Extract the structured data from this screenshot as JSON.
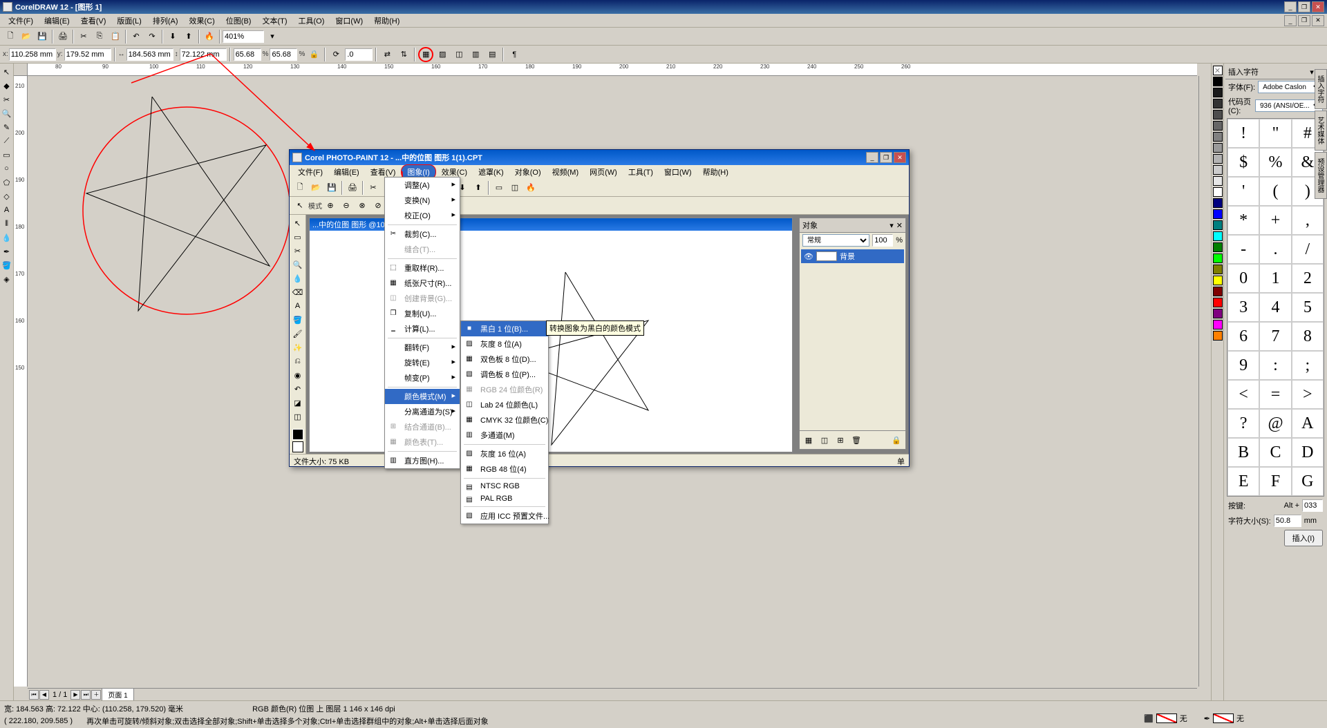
{
  "app": {
    "title": "CorelDRAW 12 - [图形 1]",
    "menubar": [
      "文件(F)",
      "编辑(E)",
      "查看(V)",
      "版面(L)",
      "排列(A)",
      "效果(C)",
      "位图(B)",
      "文本(T)",
      "工具(O)",
      "窗口(W)",
      "帮助(H)"
    ]
  },
  "toolbar": {
    "zoom": "401%"
  },
  "property": {
    "x_label": "x:",
    "y_label": "y:",
    "x": "110.258 mm",
    "y": "179.52 mm",
    "w_icon": "↔",
    "h_icon": "↕",
    "w": "184.563 mm",
    "h": "72.122 mm",
    "sx": "65.68",
    "sy": "65.68",
    "pct": "%",
    "rotate": ".0"
  },
  "ruler_h": [
    "80",
    "90",
    "100",
    "110",
    "120",
    "130",
    "140",
    "150",
    "160",
    "170",
    "180",
    "190",
    "200",
    "210",
    "220",
    "230",
    "240",
    "250",
    "260"
  ],
  "ruler_v": [
    "210",
    "200",
    "190",
    "180",
    "170",
    "160",
    "150"
  ],
  "page_nav": {
    "first": "⏮",
    "prev": "◀",
    "indicator": "1 / 1",
    "next": "▶",
    "last": "⏭",
    "add": "＋",
    "tab": "页面 1"
  },
  "status": {
    "line1_a": "宽: 184.563 高: 72.122 中心: (110.258, 179.520)  毫米",
    "line1_b": "RGB 颜色(R) 位图 上 图层 1 146 x 146 dpi",
    "line2_a": "( 222.180, 209.585 )",
    "line2_b": "再次单击可旋转/倾斜对象;双击选择全部对象;Shift+单击选择多个对象;Ctrl+单击选择群组中的对象;Alt+单击选择后面对象",
    "fill_none": "无",
    "outline_none": "无"
  },
  "right_panel": {
    "title": "插入字符",
    "font_label": "字体(F):",
    "font": "Adobe Caslon",
    "codepage_label": "代码页(C):",
    "codepage": "936  (ANSI/OE...",
    "chars": [
      "!",
      "\"",
      "#",
      "$",
      "%",
      "&",
      "'",
      "(",
      ")",
      "*",
      "+",
      ",",
      "-",
      ".",
      "/",
      "0",
      "1",
      "2",
      "3",
      "4",
      "5",
      "6",
      "7",
      "8",
      "9",
      ":",
      ";",
      "<",
      "=",
      ">",
      "?",
      "@",
      "A",
      "B",
      "C",
      "D",
      "E",
      "F",
      "G"
    ],
    "key_label": "按键:",
    "alt": "Alt +",
    "alt_val": "033",
    "size_label": "字符大小(S):",
    "size": "50.8",
    "unit": "mm",
    "insert": "插入(I)"
  },
  "colors": [
    "#ffffff",
    "#000000",
    "#1a1a1a",
    "#333333",
    "#4d4d4d",
    "#666666",
    "#808080",
    "#999999",
    "#b3b3b3",
    "#cccccc",
    "#00ffff",
    "#0000ff",
    "#ff00ff",
    "#ff0000",
    "#ffff00",
    "#00ff00",
    "#ff8000",
    "#8000ff",
    "#804000",
    "#c0e0ff"
  ],
  "photopaint": {
    "title": "Corel PHOTO-PAINT 12 - ...中的位图 图形 1(1).CPT",
    "menubar": [
      "文件(F)",
      "编辑(E)",
      "查看(V)",
      "图象(I)",
      "效果(C)",
      "遮罩(K)",
      "对象(O)",
      "视频(M)",
      "网页(W)",
      "工具(T)",
      "窗口(W)",
      "帮助(H)"
    ],
    "mode_label": "模式",
    "doc_title": "...中的位图 图形                           @100% - 背景",
    "object_panel": {
      "title": "对象",
      "mode": "常规",
      "opacity": "100",
      "pct": "%",
      "bg": "背景"
    },
    "status": "文件大小:  75 KB",
    "status_right": "单"
  },
  "image_menu": {
    "items": [
      {
        "label": "调整(A)",
        "arrow": true
      },
      {
        "label": "变换(N)",
        "arrow": true
      },
      {
        "label": "校正(O)",
        "arrow": true
      },
      {
        "sep": true
      },
      {
        "label": "裁剪(C)...",
        "icon": "✂"
      },
      {
        "label": "缝合(T)...",
        "disabled": true
      },
      {
        "sep": true
      },
      {
        "label": "重取样(R)...",
        "icon": "⬚"
      },
      {
        "label": "纸张尺寸(R)...",
        "icon": "▦"
      },
      {
        "label": "创建背景(G)...",
        "disabled": true,
        "icon": "◫"
      },
      {
        "label": "复制(U)...",
        "icon": "❐"
      },
      {
        "label": "计算(L)...",
        "icon": "‗"
      },
      {
        "sep": true
      },
      {
        "label": "翻转(F)",
        "arrow": true
      },
      {
        "label": "旋转(E)",
        "arrow": true
      },
      {
        "label": "帧变(P)",
        "arrow": true
      },
      {
        "sep": true
      },
      {
        "label": "颜色模式(M)",
        "arrow": true,
        "highlight": true
      },
      {
        "label": "分离通道为(S)",
        "arrow": true
      },
      {
        "label": "结合通道(B)...",
        "disabled": true,
        "icon": "⊞"
      },
      {
        "label": "颜色表(T)...",
        "disabled": true,
        "icon": "▦"
      },
      {
        "sep": true
      },
      {
        "label": "直方图(H)...",
        "icon": "▥"
      }
    ]
  },
  "colormode_menu": {
    "items": [
      {
        "label": "黑白 1 位(B)...",
        "highlight": true,
        "icon": "■"
      },
      {
        "label": "灰度 8 位(A)",
        "icon": "▨"
      },
      {
        "label": "双色板 8 位(D)...",
        "icon": "▦"
      },
      {
        "label": "调色板 8 位(P)...",
        "icon": "▧"
      },
      {
        "label": "RGB 24 位颜色(R)",
        "disabled": true,
        "icon": "▦"
      },
      {
        "label": "Lab 24 位颜色(L)",
        "icon": "◫"
      },
      {
        "label": "CMYK 32 位颜色(C)",
        "icon": "▦"
      },
      {
        "label": "多通道(M)",
        "icon": "▥"
      },
      {
        "sep": true
      },
      {
        "label": "灰度 16 位(A)",
        "icon": "▨"
      },
      {
        "label": "RGB 48 位(4)",
        "icon": "▦"
      },
      {
        "sep": true
      },
      {
        "label": "NTSC RGB",
        "icon": "▤"
      },
      {
        "label": "PAL RGB",
        "icon": "▤"
      },
      {
        "sep": true
      },
      {
        "label": "应用 ICC 预置文件...",
        "icon": "▧"
      }
    ]
  },
  "tooltip": "转换图象为黑白的颜色模式",
  "side_tabs": [
    "插入字符",
    "艺术媒体",
    "预设管理器"
  ]
}
